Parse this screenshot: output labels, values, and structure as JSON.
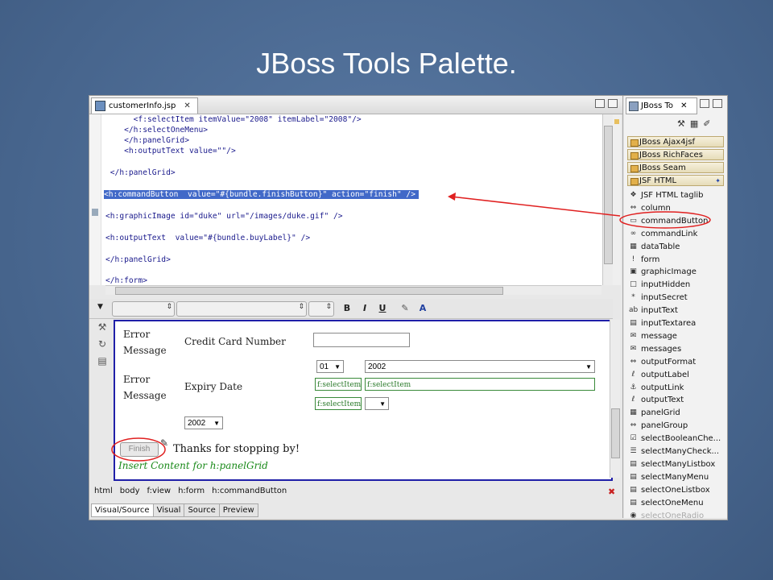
{
  "slide": {
    "title": "JBoss Tools Palette."
  },
  "editor": {
    "tab_label": "customerInfo.jsp",
    "code_lines": [
      "      <f:selectItem itemValue=\"2008\" itemLabel=\"2008\"/>",
      "    </h:selectOneMenu>",
      "    </h:panelGrid>",
      "    <h:outputText value=\"\"/>",
      "",
      " </h:panelGrid>",
      "",
      "<h:commandButton  value=\"#{bundle.finishButton}\" action=\"finish\" />",
      "",
      "<h:graphicImage id=\"duke\" url=\"/images/duke.gif\" />",
      "",
      "<h:outputText  value=\"#{bundle.buyLabel}\" />",
      "",
      "</h:panelGrid>",
      "",
      "</h:form>"
    ],
    "selected_line_index": 7
  },
  "toolbar": {
    "bold": "B",
    "italic": "I",
    "underline": "U"
  },
  "visual": {
    "error_message_1": "Error Message",
    "error_message_2": "Error Message",
    "credit_label": "Credit Card Number",
    "expiry_label": "Expiry Date",
    "month_value": "01",
    "year_value_1": "2002",
    "select_item_1": "f:selectItem",
    "select_item_2": "f:selectItem",
    "select_item_3": "f:selectItem",
    "year_value_2": "2002",
    "finish_label": "Finish",
    "thanks_text": "Thanks for stopping by!",
    "insert_text": "Insert Content for h:panelGrid"
  },
  "breadcrumbs": [
    "html",
    "body",
    "f:view",
    "h:form",
    "h:commandButton"
  ],
  "bottom_tabs": [
    "Visual/Source",
    "Visual",
    "Source",
    "Preview"
  ],
  "palette": {
    "tab_label": "JBoss To",
    "groups": [
      "JBoss Ajax4jsf",
      "JBoss RichFaces",
      "JBoss Seam",
      "JSF HTML"
    ],
    "items": [
      "JSF HTML taglib",
      "column",
      "commandButton",
      "commandLink",
      "dataTable",
      "form",
      "graphicImage",
      "inputHidden",
      "inputSecret",
      "inputText",
      "inputTextarea",
      "message",
      "messages",
      "outputFormat",
      "outputLabel",
      "outputLink",
      "outputText",
      "panelGrid",
      "panelGroup",
      "selectBooleanChe...",
      "selectManyCheck...",
      "selectManyListbox",
      "selectManyMenu",
      "selectOneListbox",
      "selectOneMenu",
      "selectOneRadio"
    ]
  },
  "colors": {
    "selection": "#4169c8",
    "annotation": "#e02020",
    "visual_border": "#1f1fa8"
  }
}
